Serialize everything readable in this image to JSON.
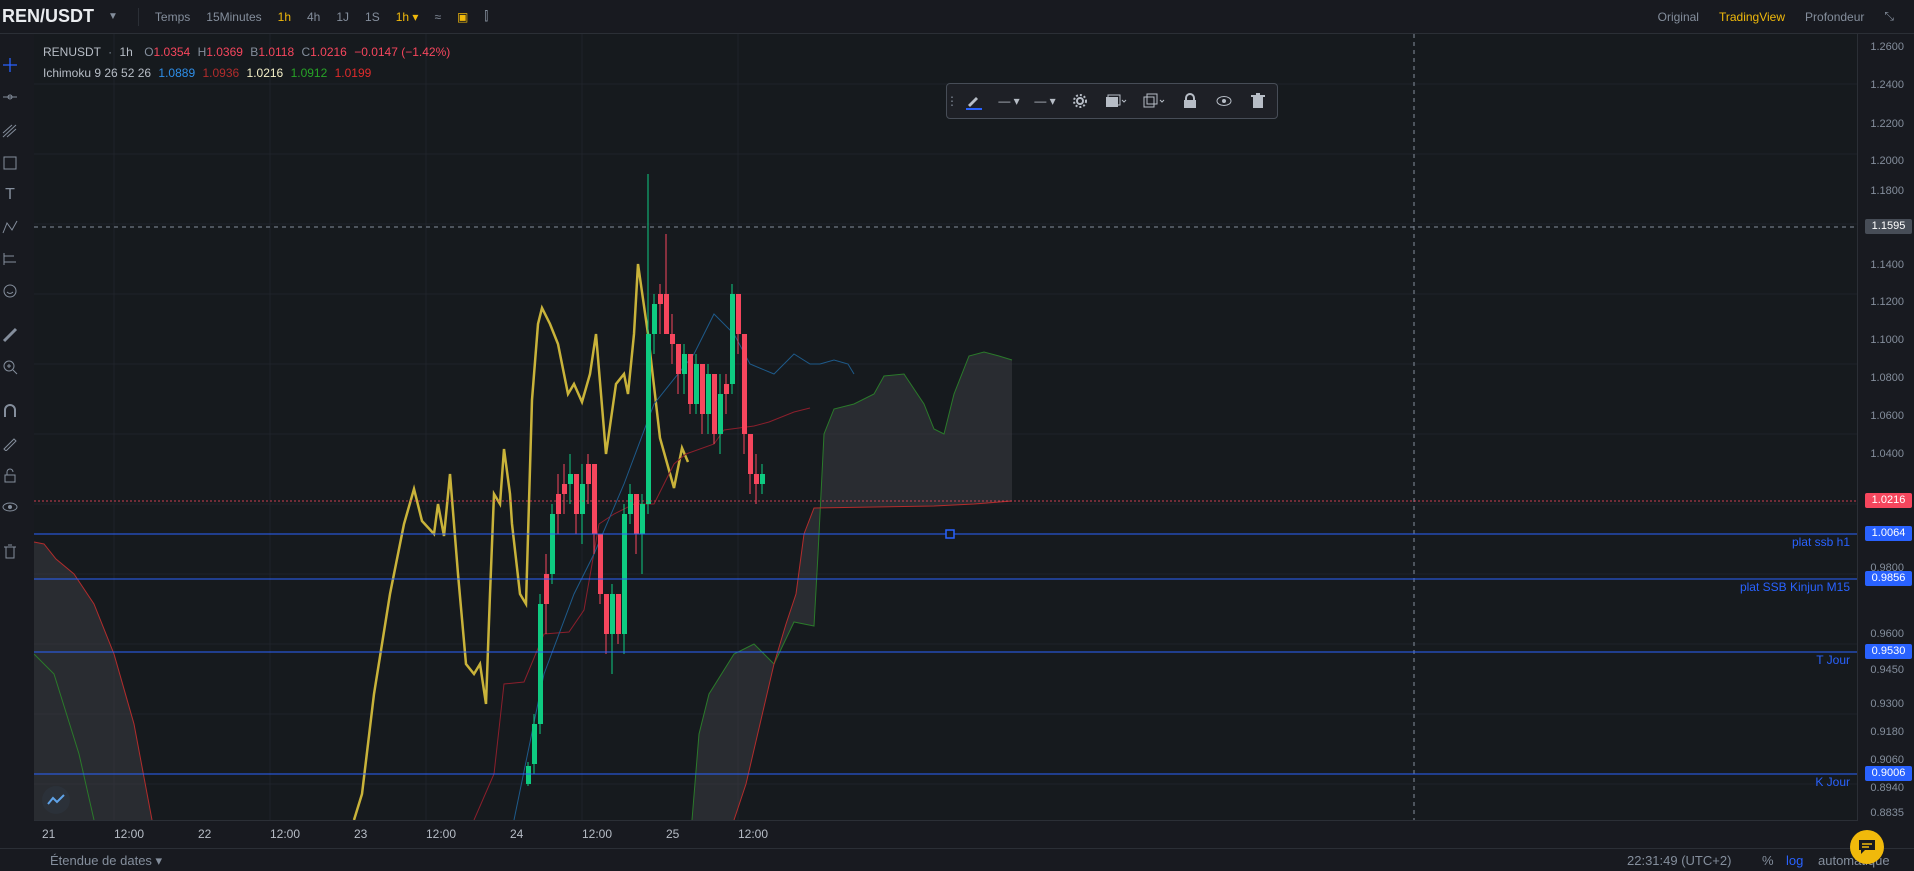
{
  "header": {
    "symbol": "REN/USDT",
    "items": [
      {
        "label": "Temps",
        "active": false
      },
      {
        "label": "15Minutes",
        "active": false
      },
      {
        "label": "1h",
        "active": true
      },
      {
        "label": "4h",
        "active": false
      },
      {
        "label": "1J",
        "active": false
      },
      {
        "label": "1S",
        "active": false
      },
      {
        "label": "1h",
        "active": true
      }
    ],
    "views": [
      {
        "label": "Original",
        "active": false
      },
      {
        "label": "TradingView",
        "active": true
      },
      {
        "label": "Profondeur",
        "active": false
      }
    ]
  },
  "legend": {
    "symbol": "RENUSDT",
    "interval": "1h",
    "open_key": "O",
    "open": "1.0354",
    "high_key": "H",
    "high": "1.0369",
    "low_key": "B",
    "low": "1.0118",
    "close_key": "C",
    "close": "1.0216",
    "change": "−0.0147 (−1.42%)",
    "indicator": "Ichimoku 9 26 52 26",
    "ind_values": [
      "1.0889",
      "1.0936",
      "1.0216",
      "1.0912",
      "1.0199"
    ]
  },
  "price_axis": {
    "ticks": [
      "1.2600",
      "1.2400",
      "1.2200",
      "1.2000",
      "1.1800",
      "1.1400",
      "1.1200",
      "1.1000",
      "1.0800",
      "1.0600",
      "1.0400",
      "0.9800",
      "0.9600",
      "0.9450",
      "0.9300",
      "0.9180",
      "0.9060",
      "0.8940",
      "0.8835"
    ],
    "crosshair_price": "1.1595",
    "last_price": "1.0216"
  },
  "horizontal_lines": [
    {
      "label": "plat ssb h1",
      "price": "1.0064"
    },
    {
      "label": "plat SSB Kinjun M15",
      "price": "0.9856"
    },
    {
      "label": "T Jour",
      "price": "0.9530"
    },
    {
      "label": "K Jour",
      "price": "0.9006"
    }
  ],
  "time_axis": {
    "labels": [
      "21",
      "12:00",
      "22",
      "12:00",
      "23",
      "12:00",
      "24",
      "12:00",
      "25",
      "12:00"
    ]
  },
  "footer": {
    "date_range": "Étendue de dates",
    "clock": "22:31:49 (UTC+2)",
    "percent": "%",
    "log": "log",
    "auto": "automatique"
  },
  "colors": {
    "up": "#0ecb81",
    "down": "#f6465d",
    "accent": "#f0b90b",
    "line_blue": "#2962ff",
    "lagging": "#c9b33a"
  },
  "icons": {
    "chat": "chat-icon",
    "logo": "chart-logo-icon"
  }
}
